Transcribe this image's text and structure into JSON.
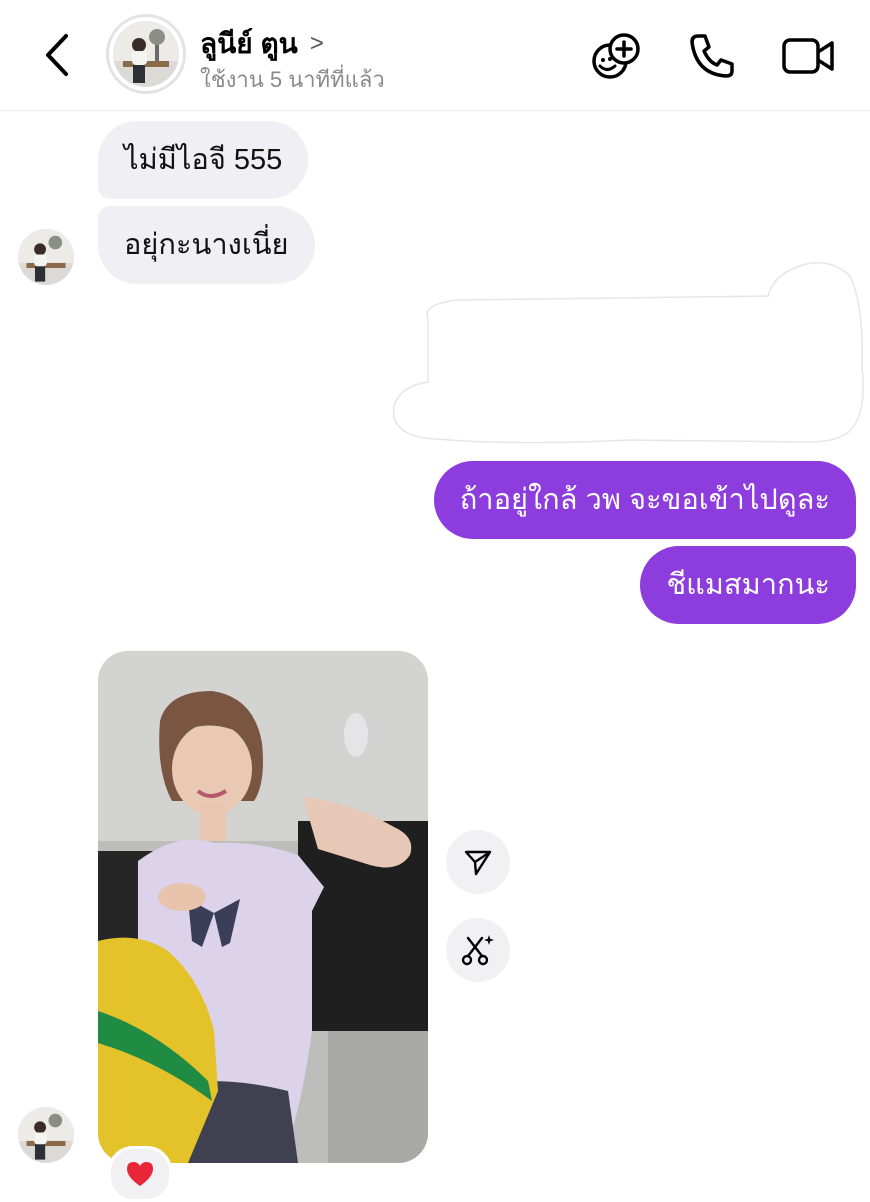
{
  "header": {
    "contact_name": "ลูนีย์ ตูน",
    "status": "ใช้งาน 5 นาทีที่แล้ว",
    "name_chevron": ">"
  },
  "messages": [
    {
      "from": "contact",
      "text": "ไม่มีไอจี 555"
    },
    {
      "from": "contact",
      "text": "อยุ่กะนางเนี่ย"
    },
    {
      "from": "me",
      "text": "ถ้าอยู่ใกล้ วพ จะขอเข้าไปดูละ"
    },
    {
      "from": "me",
      "text": "ชีแมสมากนะ"
    }
  ],
  "photo_reaction": "❤️",
  "icons": {
    "back": "chevron-left-icon",
    "effects": "face-plus-icon",
    "call": "phone-icon",
    "video": "video-camera-icon",
    "share": "send-icon",
    "cut": "scissors-sparkle-icon"
  },
  "colors": {
    "sent_bubble": "#8d3cde",
    "received_bubble": "#efeff4",
    "status_text": "#8a8a8a"
  }
}
